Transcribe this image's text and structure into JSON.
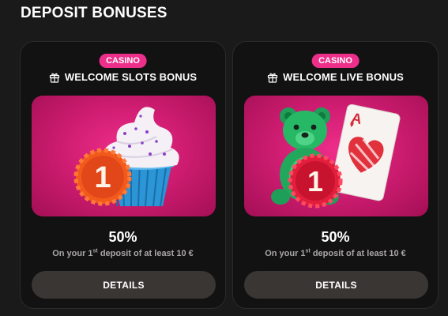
{
  "section": {
    "title": "DEPOSIT BONUSES"
  },
  "cards": [
    {
      "badge": "CASINO",
      "icon": "gift-icon",
      "title": "WELCOME SLOTS BONUS",
      "image": "cupcake-number-one-illustration",
      "percent": "50%",
      "deposit_prefix": "On your 1",
      "deposit_sup": "st",
      "deposit_suffix": " deposit of at least 10 €",
      "button_label": "DETAILS"
    },
    {
      "badge": "CASINO",
      "icon": "gift-icon",
      "title": "WELCOME LIVE BONUS",
      "image": "teddy-bear-ace-of-hearts-illustration",
      "percent": "50%",
      "deposit_prefix": "On your 1",
      "deposit_sup": "st",
      "deposit_suffix": " deposit of at least 10 €",
      "button_label": "DETAILS"
    }
  ],
  "banner_text": "1",
  "card_rank": "A",
  "colors": {
    "background": "#1b1a1a",
    "card": "#131212",
    "badge": "#ec2f8a",
    "banner": "#d01d72",
    "button": "#3a3633",
    "subtext": "#a9a6a6"
  }
}
